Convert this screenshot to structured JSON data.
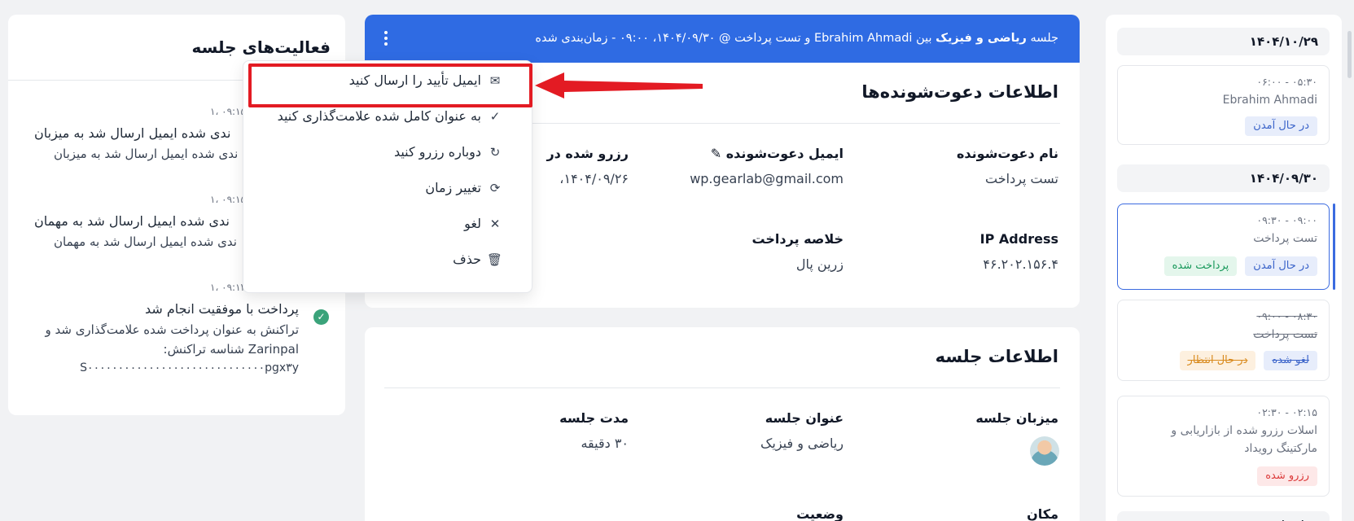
{
  "sidebar": {
    "groups": [
      {
        "date": "۱۴۰۴/۱۰/۲۹",
        "slots": [
          {
            "time": "۰۵:۳۰ - ۰۶:۰۰",
            "name": "Ebrahim Ahmadi",
            "badges": [
              {
                "label": "در حال آمدن",
                "color": "blue"
              }
            ]
          }
        ]
      },
      {
        "date": "۱۴۰۴/۰۹/۳۰",
        "slots": [
          {
            "time": "۰۹:۰۰ - ۰۹:۳۰",
            "name": "تست پرداخت",
            "badges": [
              {
                "label": "در حال آمدن",
                "color": "blue"
              },
              {
                "label": "پرداخت شده",
                "color": "green"
              }
            ]
          },
          {
            "time": "۰۸:۳۰ - ۰۹:۰۰",
            "name": "تست پرداخت",
            "badges": [
              {
                "label": "لغو شده",
                "color": "blue"
              },
              {
                "label": "در حال انتظار",
                "color": "orange"
              }
            ]
          },
          {
            "time": "۰۲:۱۵ - ۰۲:۳۰",
            "name_line1": "اسلات رزرو شده از بازاریابی و",
            "name_line2": "مارکتینگ رویداد",
            "badges": [
              {
                "label": "رزرو شده",
                "color": "red"
              }
            ]
          }
        ]
      }
    ],
    "partial_date": "۱۴۰۴/۰۹/۲۶"
  },
  "header": {
    "prefix": "جلسه",
    "topic": "ریاضی و فیزیک",
    "between": "بین",
    "host": "Ebrahim Ahmadi",
    "and": "و",
    "guest": "تست پرداخت",
    "rest": "@ ۱۴۰۴/۰۹/۳۰، ۰۹:۰۰ - زمان‌بندی شده"
  },
  "invitee": {
    "title": "اطلاعات دعوت‌شونده‌ها",
    "name_label": "نام دعوت‌شونده",
    "name_value": "تست پرداخت",
    "email_label": "ایمیل دعوت‌شونده",
    "email_value": "wp.gearlab@gmail.com",
    "booked_label": "رزرو شده در",
    "booked_value": "۱۴۰۴/۰۹/۲۶،",
    "ip_label": "IP Address",
    "ip_value": "۴۶.۲۰۲.۱۵۶.۴",
    "payment_label": "خلاصه پرداخت",
    "payment_value": "زرین پال"
  },
  "session": {
    "title": "اطلاعات جلسه",
    "host_label": "میزبان جلسه",
    "topic_label": "عنوان جلسه",
    "topic_value": "ریاضی و فیزیک",
    "duration_label": "مدت جلسه",
    "duration_value": "۳۰ دقیقه",
    "location_label": "مکان",
    "status_label": "وضعیت"
  },
  "activity": {
    "title": "فعالیت‌های جلسه",
    "items": [
      {
        "time": "۰۹:۱۵ ،۱",
        "title": "ندی شده ایمیل ارسال شد به میزبان",
        "sub": "ندی شده ایمیل ارسال شد به میزبان"
      },
      {
        "time": "۰۹:۱۵ ،۱",
        "title": "ندی شده ایمیل ارسال شد به مهمان",
        "sub": "ندی شده ایمیل ارسال شد به مهمان"
      },
      {
        "time": "۰۹:۱۴ ،۱",
        "title": "پرداخت با موفقیت انجام شد",
        "sub1": "تراکنش به عنوان پرداخت شده علامت‌گذاری شد و",
        "sub2": "Zarinpal شناسه تراکنش:",
        "sub3": "S۰۰۰۰۰۰۰۰۰۰۰۰۰۰۰۰۰۰۰۰۰۰۰۰۰۰۰۰۰pgx۳y"
      }
    ]
  },
  "menu": {
    "items": [
      {
        "label": "ایمیل تأیید را ارسال کنید",
        "icon": "mail-icon"
      },
      {
        "label": "به عنوان کامل شده علامت‌گذاری کنید",
        "icon": "check-icon"
      },
      {
        "label": "دوباره رزرو کنید",
        "icon": "refresh-icon"
      },
      {
        "label": "تغییر زمان",
        "icon": "reschedule-icon"
      },
      {
        "label": "لغو",
        "icon": "close-icon"
      },
      {
        "label": "حذف",
        "icon": "trash-icon"
      }
    ]
  },
  "colors": {
    "primary": "#2f6be3",
    "annotation": "#e31b23"
  }
}
